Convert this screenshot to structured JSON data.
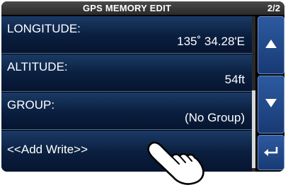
{
  "titlebar": {
    "title": "GPS MEMORY EDIT",
    "page_indicator": "2/2"
  },
  "rows": [
    {
      "label": "LONGITUDE:",
      "value": "135˚ 34.28'E"
    },
    {
      "label": "ALTITUDE:",
      "value": "54ft"
    },
    {
      "label": "GROUP:",
      "value": "(No Group)"
    },
    {
      "label": "<<Add Write>>"
    }
  ],
  "scrollbar": {
    "position_fraction": 0.5
  },
  "side_buttons": {
    "up_icon": "triangle-up-icon",
    "down_icon": "triangle-down-icon",
    "back_icon": "return-arrow-icon"
  },
  "colors": {
    "row_top": "#1a3a66",
    "row_bottom": "#061530",
    "button": "#2d5aa0",
    "background": "#000000"
  },
  "overlay": {
    "icon": "pointing-hand-icon"
  }
}
